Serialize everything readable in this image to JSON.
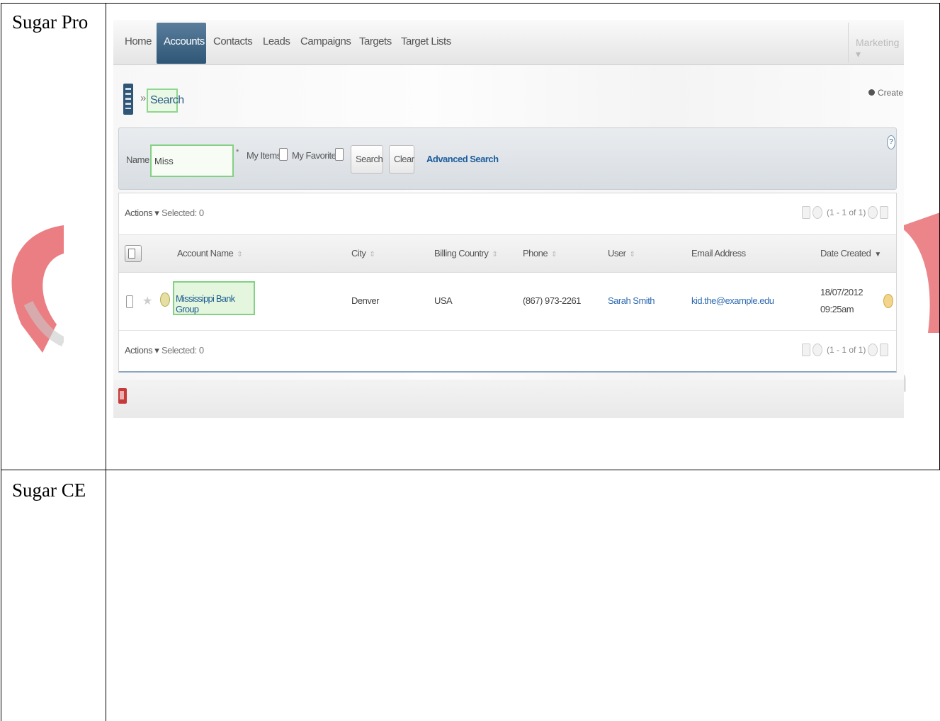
{
  "document": {
    "row_labels": [
      "Sugar Pro",
      "Sugar CE"
    ]
  },
  "watermark": {
    "text": "n"
  },
  "app": {
    "nav": {
      "items": [
        "Home",
        "Accounts",
        "Contacts",
        "Leads",
        "Campaigns",
        "Targets",
        "Target Lists"
      ],
      "active": "Accounts",
      "right_menu": "Marketing ▾"
    },
    "breadcrumb": {
      "separator": "»",
      "title": "Search"
    },
    "create_label": "Create",
    "search": {
      "name_label": "Name",
      "name_value": "Miss",
      "required_mark": "*",
      "my_items_label": "My Items",
      "my_favorites_label": "My Favorites",
      "search_button": "Search",
      "clear_button": "Clear",
      "advanced_link": "Advanced Search",
      "help": "?"
    },
    "list": {
      "actions_label": "Actions ▾",
      "selected_label": "Selected: 0",
      "pagination": "(1 - 1 of 1)",
      "columns": [
        "Account Name",
        "City",
        "Billing Country",
        "Phone",
        "User",
        "Email Address",
        "Date Created"
      ],
      "rows": [
        {
          "account_name": "Mississippi Bank Group",
          "city": "Denver",
          "billing_country": "USA",
          "phone": "(867) 973-2261",
          "user": "Sarah Smith",
          "email": "kid.the@example.edu",
          "date_created": "18/07/2012",
          "time_created": "09:25am"
        }
      ]
    }
  }
}
